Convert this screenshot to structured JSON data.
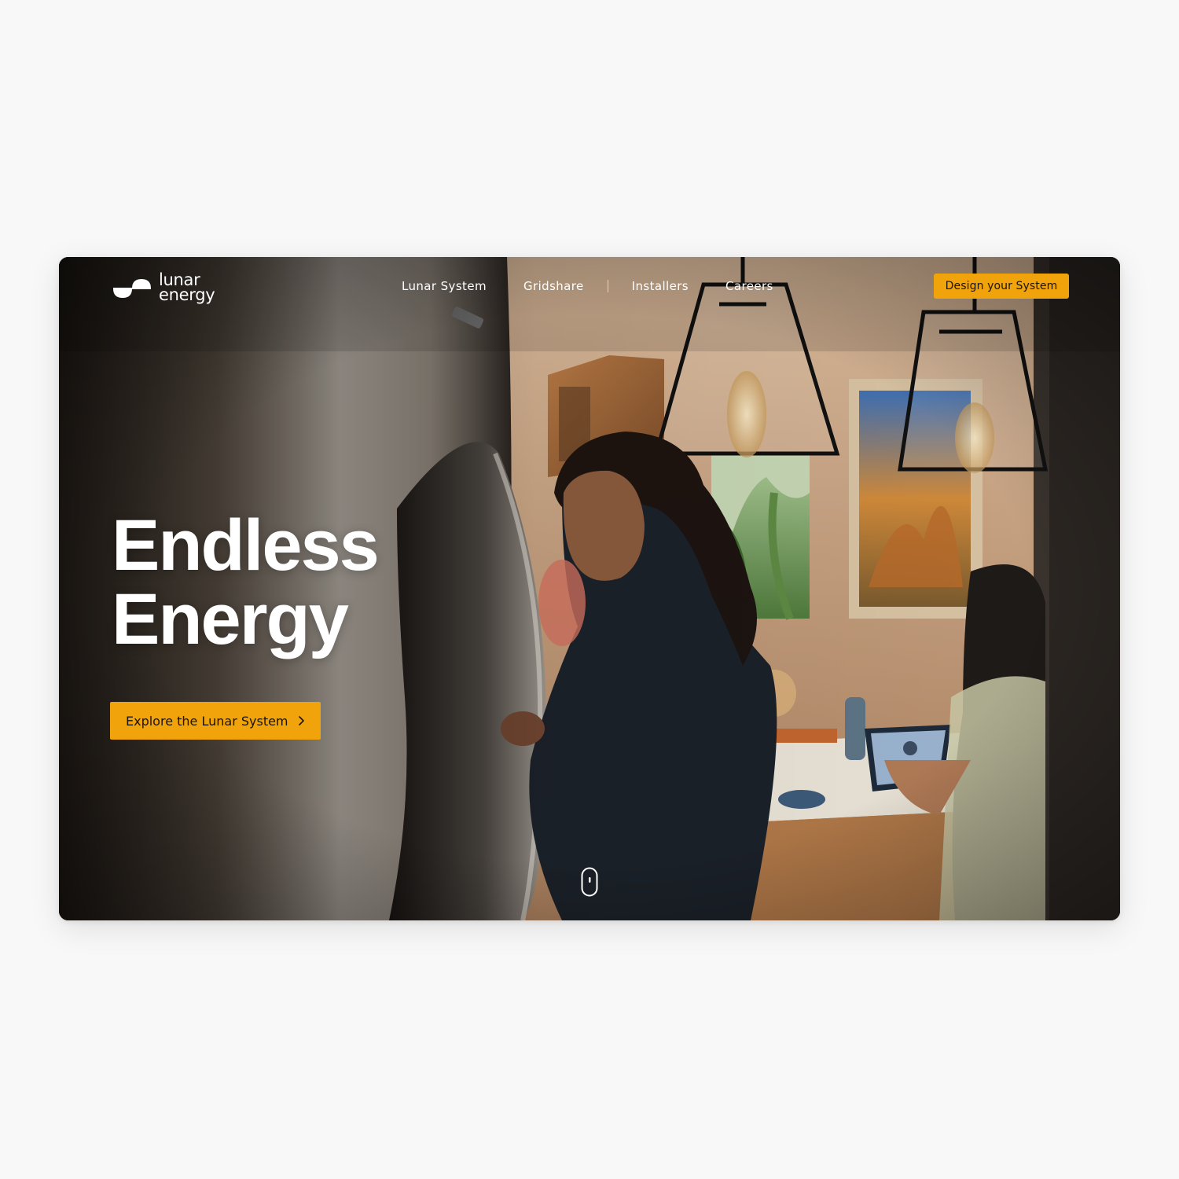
{
  "brand": {
    "name_line1": "lunar",
    "name_line2": "energy"
  },
  "nav": {
    "items": [
      {
        "label": "Lunar System"
      },
      {
        "label": "Gridshare"
      },
      {
        "label": "Installers"
      },
      {
        "label": "Careers"
      }
    ]
  },
  "header": {
    "cta_label": "Design your System"
  },
  "hero": {
    "headline_line1": "Endless",
    "headline_line2": "Energy",
    "cta_label": "Explore the Lunar System",
    "background_description_icon": "kitchen-photo"
  },
  "colors": {
    "accent": "#f0a30a",
    "text_on_dark": "#ffffff",
    "page_bg": "#f8f8f8"
  },
  "icons": {
    "cta_arrow": "chevron-right-icon",
    "scroll": "scroll-mouse-icon",
    "logo": "lunar-logo-icon"
  }
}
